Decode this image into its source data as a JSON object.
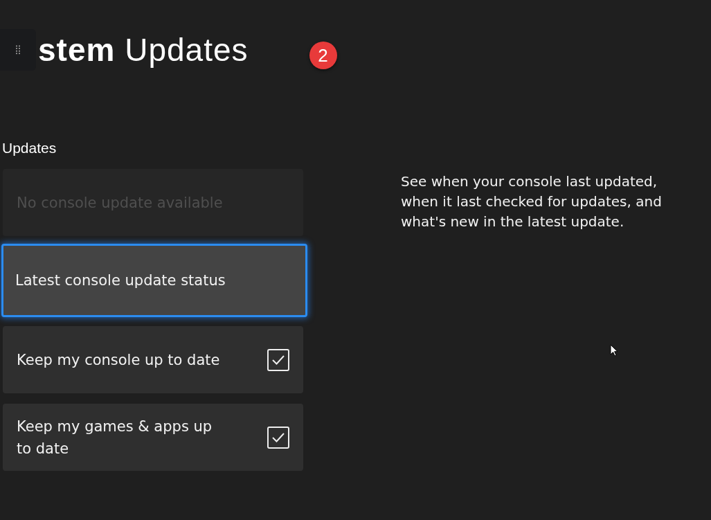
{
  "header": {
    "title": "**stem** Updates",
    "badge": "2"
  },
  "section": {
    "title": "Updates"
  },
  "items": [
    {
      "kind": "button",
      "label": "No console update available",
      "disabled": true,
      "focused": false
    },
    {
      "kind": "button",
      "label": "Latest console update status",
      "disabled": false,
      "focused": true
    },
    {
      "kind": "checkbox",
      "label": "Keep my console up to date",
      "disabled": false,
      "focused": false,
      "checked": true
    },
    {
      "kind": "checkbox",
      "label": "Keep my games & apps up to date",
      "disabled": false,
      "focused": false,
      "checked": true
    }
  ],
  "description": "See when your console last updated, when it last checked for updates, and what's new in the latest update."
}
